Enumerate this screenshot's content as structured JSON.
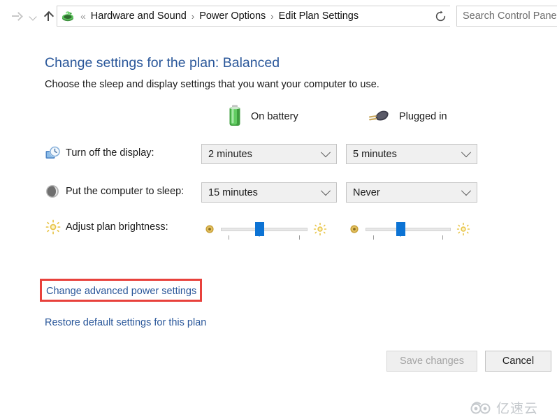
{
  "window": {
    "nav": {
      "forward_label": "Forward",
      "history_label": "Recent locations",
      "up_label": "Up one level",
      "refresh_label": "Refresh"
    },
    "address": {
      "icon": "control-panel-power-icon",
      "double_chevron": "«",
      "separator": "›",
      "breadcrumbs": [
        {
          "label": "Hardware and Sound"
        },
        {
          "label": "Power Options"
        },
        {
          "label": "Edit Plan Settings"
        }
      ]
    },
    "search": {
      "placeholder": "Search Control Panel",
      "value": ""
    }
  },
  "page": {
    "title": "Change settings for the plan: Balanced",
    "subtitle": "Choose the sleep and display settings that you want your computer to use."
  },
  "columns": [
    {
      "icon": "battery-icon",
      "label": "On battery"
    },
    {
      "icon": "power-plug-icon",
      "label": "Plugged in"
    }
  ],
  "settings": [
    {
      "icon": "display-clock-icon",
      "label": "Turn off the display:",
      "type": "dropdown",
      "battery_value": "2 minutes",
      "plugged_value": "5 minutes"
    },
    {
      "icon": "sleep-moon-icon",
      "label": "Put the computer to sleep:",
      "type": "dropdown",
      "battery_value": "15 minutes",
      "plugged_value": "Never"
    },
    {
      "icon": "brightness-sun-icon",
      "label": "Adjust plan brightness:",
      "type": "slider",
      "battery_value": 42,
      "plugged_value": 40,
      "dim_icon": "dim-sun-icon",
      "bright_icon": "bright-sun-icon"
    }
  ],
  "links": [
    {
      "label": "Change advanced power settings",
      "highlighted": true
    },
    {
      "label": "Restore default settings for this plan",
      "highlighted": false
    }
  ],
  "buttons": {
    "save": {
      "label": "Save changes",
      "enabled": false
    },
    "cancel": {
      "label": "Cancel",
      "enabled": true
    }
  },
  "watermark": {
    "text": "亿速云"
  },
  "colors": {
    "link": "#2a579a",
    "title": "#2a579a",
    "highlight_box": "#e8413c",
    "slider_thumb": "#0c73d4",
    "battery_green": "#4db84d"
  }
}
